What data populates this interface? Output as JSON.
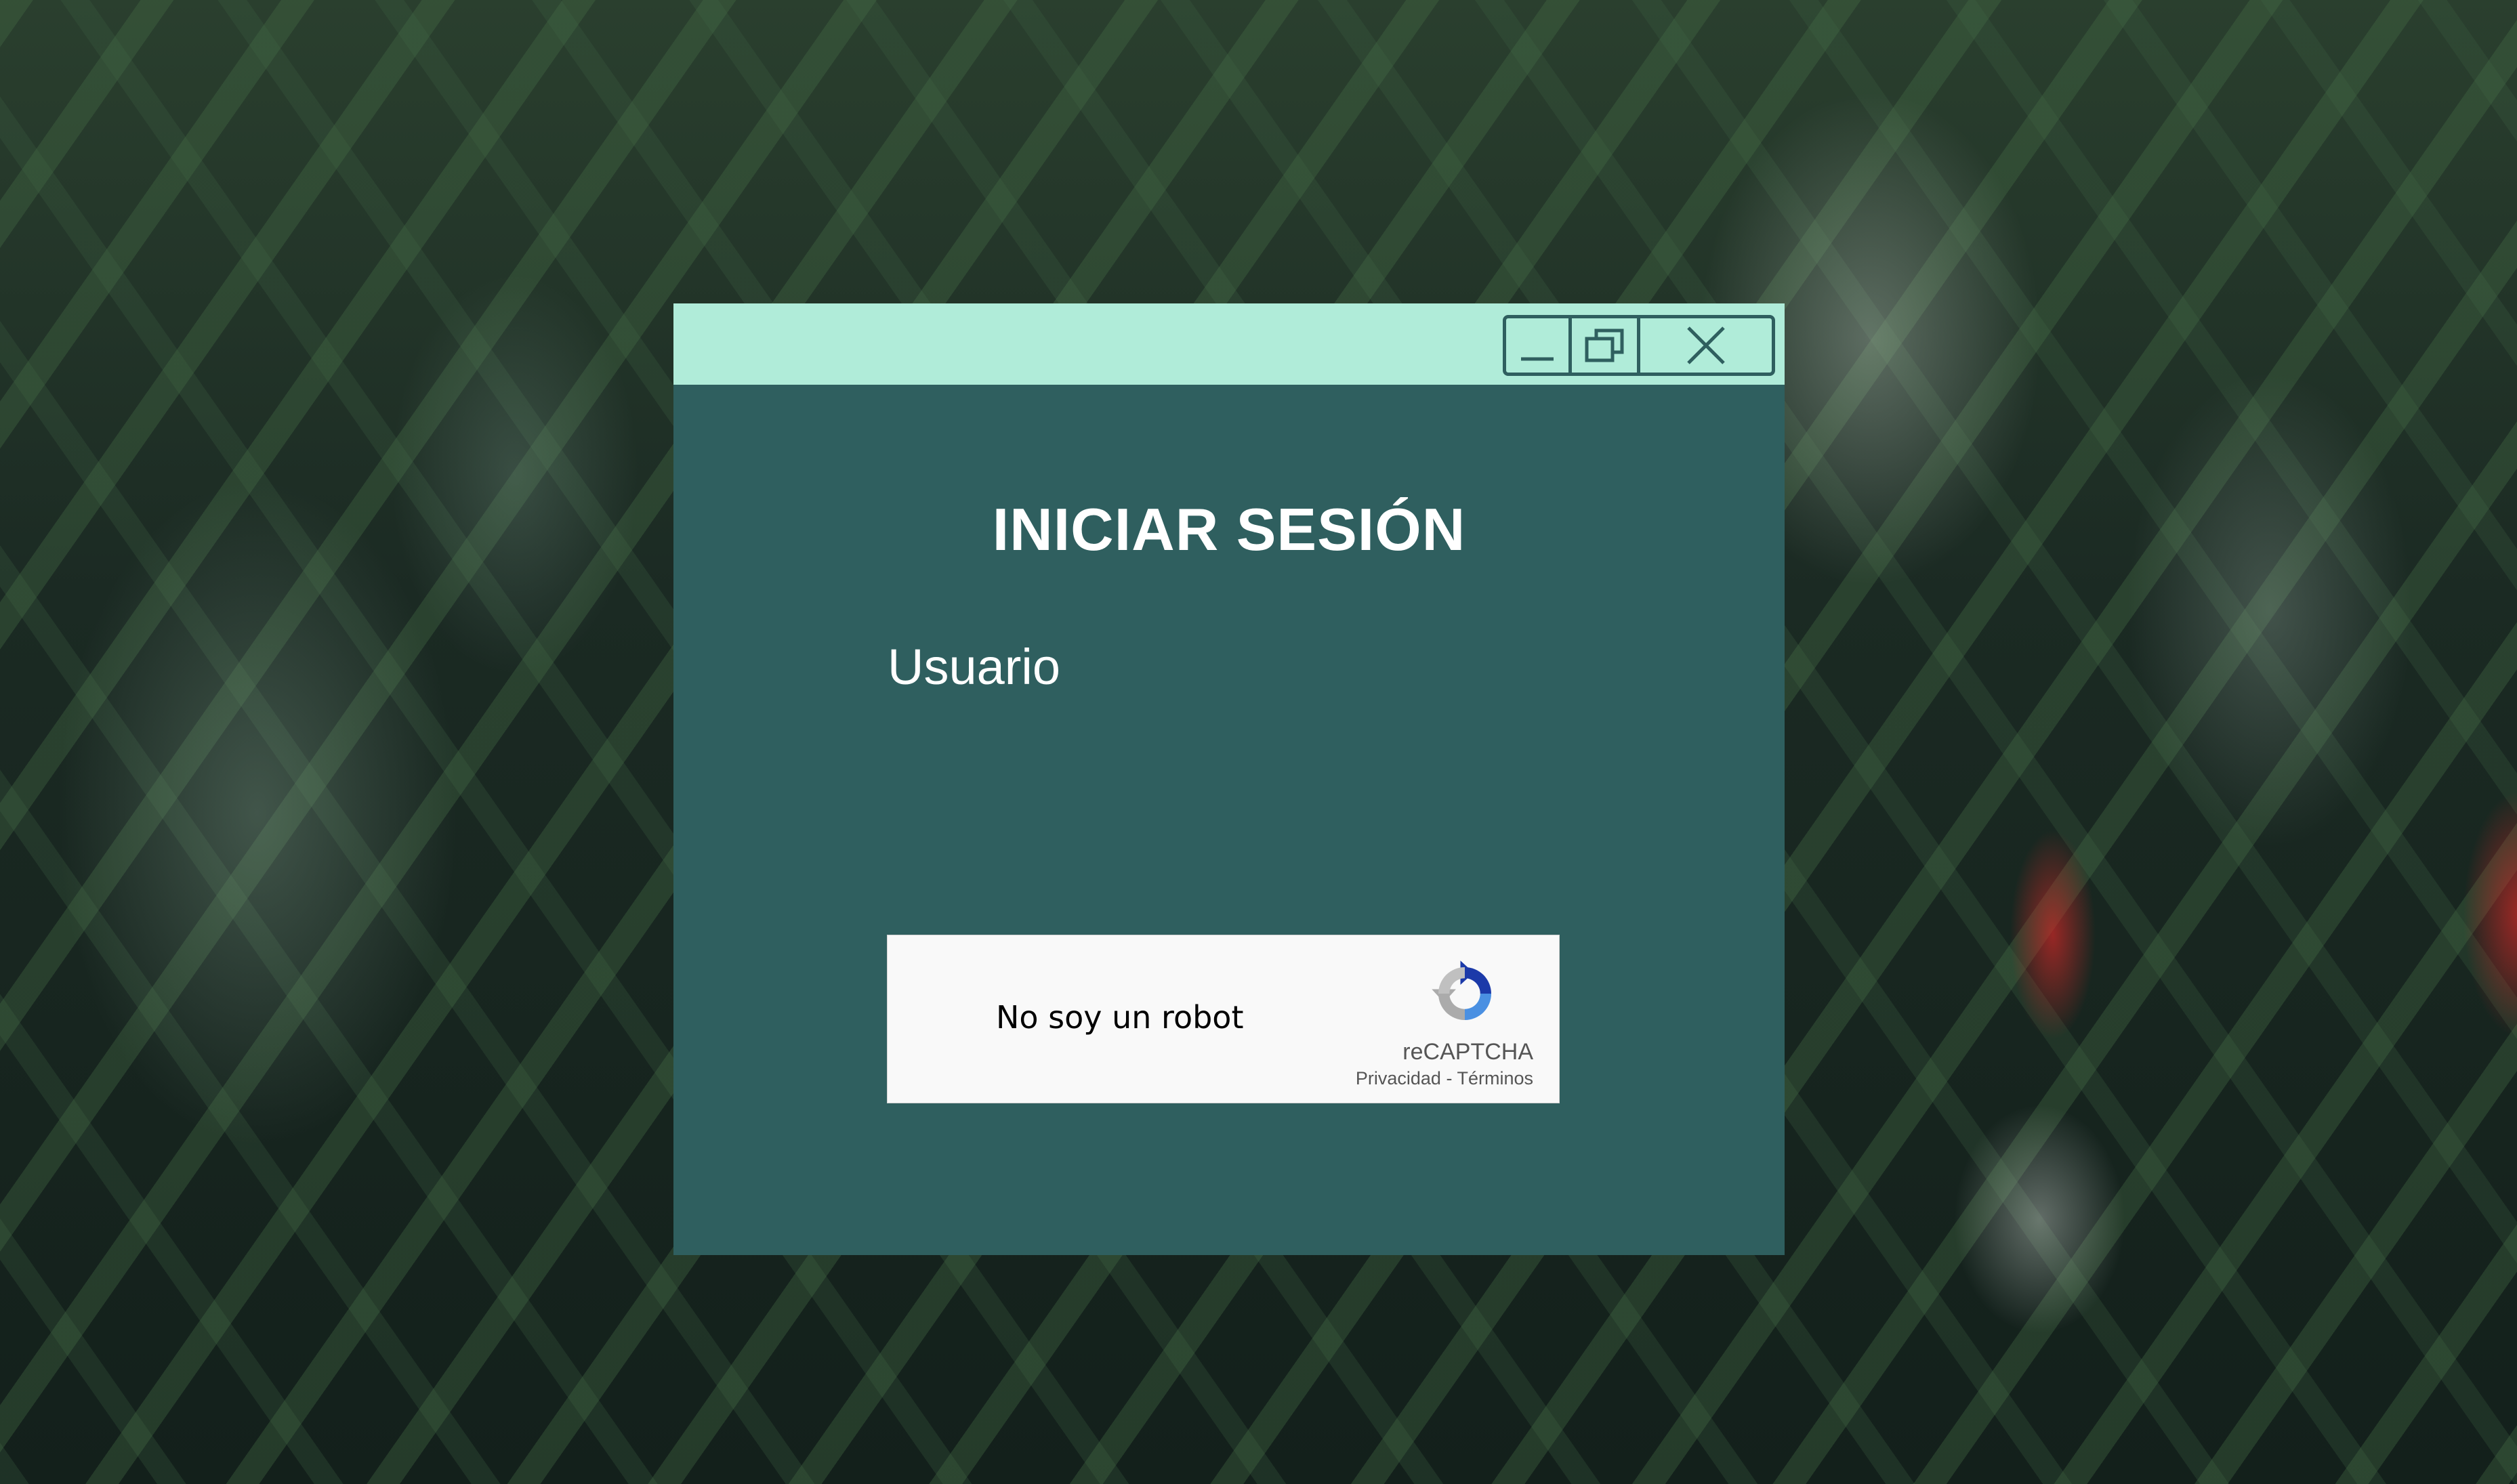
{
  "login": {
    "title": "INICIAR SESIÓN",
    "username_label": "Usuario"
  },
  "window_controls": {
    "minimize_icon": "minimize-icon",
    "restore_icon": "restore-icon",
    "close_icon": "close-icon"
  },
  "recaptcha": {
    "label": "No soy un robot",
    "brand": "reCAPTCHA",
    "privacy_link": "Privacidad",
    "separator": " - ",
    "terms_link": "Términos"
  },
  "colors": {
    "window_body": "#2f5f5f",
    "title_bar": "#b0ecd9",
    "text": "#ffffff",
    "recaptcha_bg": "#f9f9f9"
  }
}
